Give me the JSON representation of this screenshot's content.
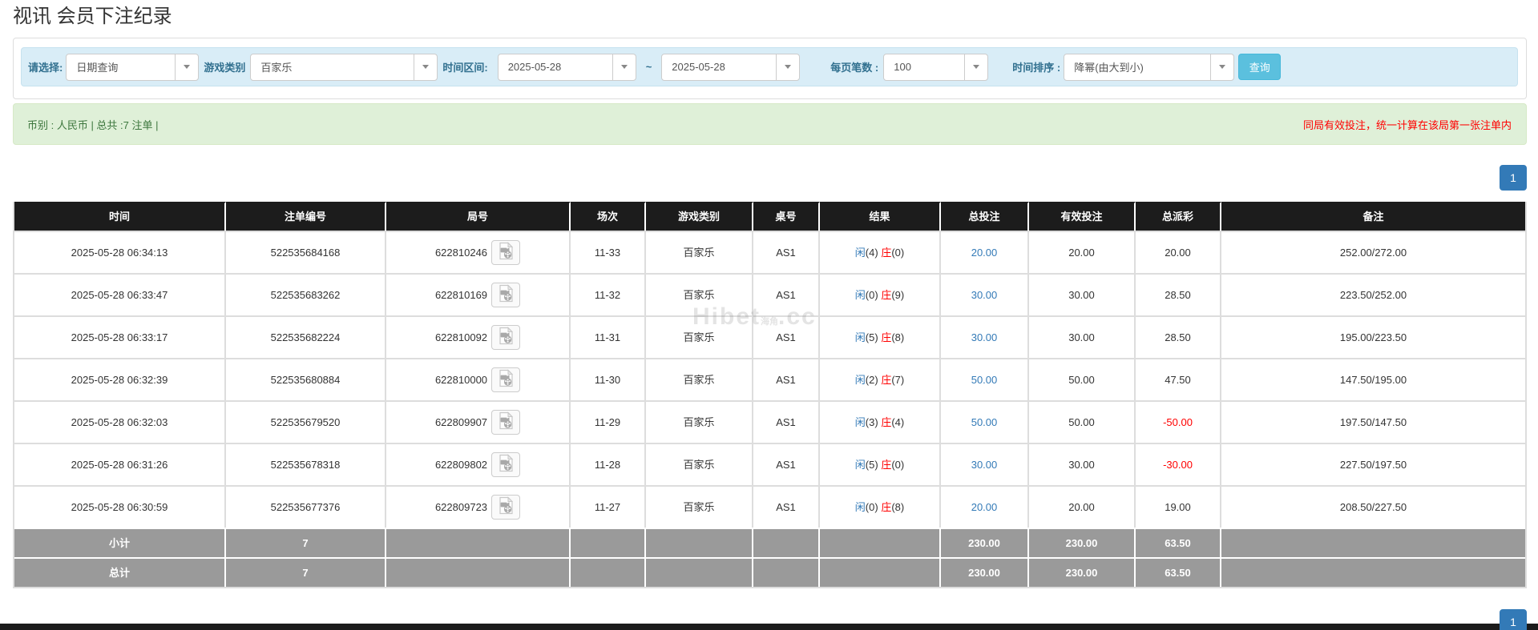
{
  "page": {
    "title": "视讯 会员下注纪录"
  },
  "filters": {
    "select_label": "请选择:",
    "select_value": "日期查询",
    "game_label": "游戏类别",
    "game_value": "百家乐",
    "range_label": "时间区间:",
    "date_from": "2025-05-28",
    "tilde": "~",
    "date_to": "2025-05-28",
    "page_size_label": "每页笔数 :",
    "page_size_value": "100",
    "sort_label": "时间排序 :",
    "sort_value": "降幂(由大到小)",
    "query_button": "查询"
  },
  "summary": {
    "left": "币别 : 人民币 | 总共 :7 注单 |",
    "right": "同局有效投注，统一计算在该局第一张注单内"
  },
  "pagination": {
    "page": "1"
  },
  "watermark": {
    "main": "Hibet",
    "small": "海角",
    "suffix": ".cc"
  },
  "result_labels": {
    "xian": "闲",
    "zhuang": "庄"
  },
  "table": {
    "columns": [
      "时间",
      "注单编号",
      "局号",
      "场次",
      "游戏类别",
      "桌号",
      "结果",
      "总投注",
      "有效投注",
      "总派彩",
      "备注"
    ],
    "rows": [
      {
        "time": "2025-05-28 06:34:13",
        "bet_no": "522535684168",
        "round_no": "622810246",
        "session": "11-33",
        "game": "百家乐",
        "table_no": "AS1",
        "xian": "4",
        "zhuang": "0",
        "total_bet": "20.00",
        "valid_bet": "20.00",
        "payout": "20.00",
        "remark": "252.00/272.00"
      },
      {
        "time": "2025-05-28 06:33:47",
        "bet_no": "522535683262",
        "round_no": "622810169",
        "session": "11-32",
        "game": "百家乐",
        "table_no": "AS1",
        "xian": "0",
        "zhuang": "9",
        "total_bet": "30.00",
        "valid_bet": "30.00",
        "payout": "28.50",
        "remark": "223.50/252.00"
      },
      {
        "time": "2025-05-28 06:33:17",
        "bet_no": "522535682224",
        "round_no": "622810092",
        "session": "11-31",
        "game": "百家乐",
        "table_no": "AS1",
        "xian": "5",
        "zhuang": "8",
        "total_bet": "30.00",
        "valid_bet": "30.00",
        "payout": "28.50",
        "remark": "195.00/223.50"
      },
      {
        "time": "2025-05-28 06:32:39",
        "bet_no": "522535680884",
        "round_no": "622810000",
        "session": "11-30",
        "game": "百家乐",
        "table_no": "AS1",
        "xian": "2",
        "zhuang": "7",
        "total_bet": "50.00",
        "valid_bet": "50.00",
        "payout": "47.50",
        "remark": "147.50/195.00"
      },
      {
        "time": "2025-05-28 06:32:03",
        "bet_no": "522535679520",
        "round_no": "622809907",
        "session": "11-29",
        "game": "百家乐",
        "table_no": "AS1",
        "xian": "3",
        "zhuang": "4",
        "total_bet": "50.00",
        "valid_bet": "50.00",
        "payout": "-50.00",
        "remark": "197.50/147.50"
      },
      {
        "time": "2025-05-28 06:31:26",
        "bet_no": "522535678318",
        "round_no": "622809802",
        "session": "11-28",
        "game": "百家乐",
        "table_no": "AS1",
        "xian": "5",
        "zhuang": "0",
        "total_bet": "30.00",
        "valid_bet": "30.00",
        "payout": "-30.00",
        "remark": "227.50/197.50"
      },
      {
        "time": "2025-05-28 06:30:59",
        "bet_no": "522535677376",
        "round_no": "622809723",
        "session": "11-27",
        "game": "百家乐",
        "table_no": "AS1",
        "xian": "0",
        "zhuang": "8",
        "total_bet": "20.00",
        "valid_bet": "20.00",
        "payout": "19.00",
        "remark": "208.50/227.50"
      }
    ],
    "subtotal": {
      "label": "小计",
      "count": "7",
      "total_bet": "230.00",
      "valid_bet": "230.00",
      "payout": "63.50"
    },
    "total": {
      "label": "总计",
      "count": "7",
      "total_bet": "230.00",
      "valid_bet": "230.00",
      "payout": "63.50"
    }
  }
}
